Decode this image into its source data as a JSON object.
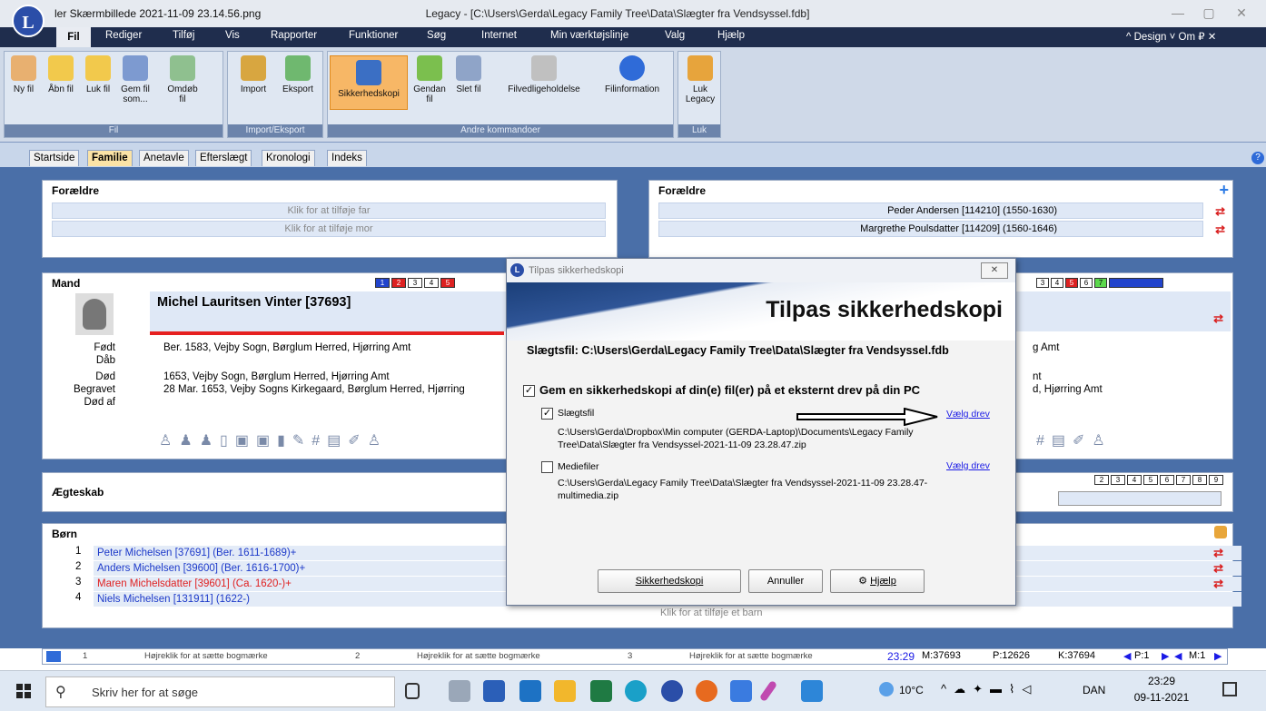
{
  "window": {
    "filename": "ler Skærmbillede 2021-11-09 23.14.56.png",
    "title": "Legacy - [C:\\Users\\Gerda\\Legacy Family Tree\\Data\\Slægter fra Vendsyssel.fdb]",
    "logo": "L"
  },
  "menu": {
    "items": [
      "Fil",
      "Rediger",
      "Tilføj",
      "Vis",
      "Rapporter",
      "Funktioner",
      "Søg",
      "Internet",
      "Min værktøjslinje",
      "Valg",
      "Hjælp"
    ],
    "right": "^ Design  ˅ Om ₽ ✕"
  },
  "ribbon": {
    "groups": [
      {
        "label": "Fil"
      },
      {
        "label": "Import/Eksport"
      },
      {
        "label": "Andre kommandoer"
      },
      {
        "label": "Luk"
      }
    ],
    "buttons": [
      "Ny fil",
      "Åbn fil",
      "Luk fil",
      "Gem fil som...",
      "Omdøb fil",
      "Import",
      "Eksport",
      "Sikkerhedskopi",
      "Gendan fil",
      "Slet fil",
      "Filvedligeholdelse",
      "Filinformation",
      "Luk Legacy"
    ]
  },
  "tabs": [
    "Startside",
    "Familie",
    "Anetavle",
    "Efterslægt",
    "Kronologi",
    "Indeks"
  ],
  "parents_left": {
    "title": "Forældre",
    "father": "Klik for at tilføje far",
    "mother": "Klik for at tilføje mor"
  },
  "parents_right": {
    "title": "Forældre",
    "father": "Peder Andersen [114210] (1550-1630)",
    "mother": "Margrethe Poulsdatter [114209] (1560-1646)"
  },
  "man": {
    "title": "Mand",
    "name": "Michel Lauritsen Vinter [37693]",
    "labels": [
      "Født",
      "Dåb",
      "Død",
      "Begravet",
      "Død af"
    ],
    "born": "Ber. 1583, Vejby Sogn, Børglum Herred, Hjørring Amt",
    "baptism": "",
    "death": "1653, Vejby Sogn, Børglum Herred, Hjørring Amt",
    "burial": "28 Mar. 1653, Vejby Sogns Kirkegaard, Børglum Herred, Hjørring",
    "right_born": "g Amt",
    "right_death": "nt",
    "right_burial": "d, Hjørring Amt",
    "colornums": [
      "1",
      "2",
      "3",
      "4",
      "5"
    ],
    "rightnums": [
      "3",
      "4",
      "5",
      "6",
      "7"
    ]
  },
  "marriage": {
    "title": "Ægteskab",
    "nums": [
      "2",
      "3",
      "4",
      "5",
      "6",
      "7",
      "8",
      "9"
    ]
  },
  "children": {
    "title": "Børn",
    "items": [
      {
        "n": "1",
        "text": "Peter Michelsen [37691] (Ber. 1611-1689)+"
      },
      {
        "n": "2",
        "text": "Anders Michelsen [39600] (Ber. 1616-1700)+"
      },
      {
        "n": "3",
        "text": "Maren Michelsdatter [39601] (Ca. 1620-)+"
      },
      {
        "n": "4",
        "text": "Niels Michelsen [131911] (1622-)"
      }
    ],
    "add": "Klik for at tilføje et barn"
  },
  "bookmarks": {
    "items": [
      "1",
      "Højreklik for at sætte bogmærke",
      "2",
      "Højreklik for at sætte bogmærke",
      "3",
      "Højreklik for at sætte bogmærke"
    ],
    "time": "23:29",
    "m": "M:37693",
    "p": "P:12626",
    "k": "K:37694",
    "pnav": "P:1",
    "mnav": "M:1"
  },
  "dialog": {
    "title": "Tilpas sikkerhedskopi",
    "heading": "Tilpas sikkerhedskopi",
    "file": "Slægtsfil: C:\\Users\\Gerda\\Legacy Family Tree\\Data\\Slægter fra Vendsyssel.fdb",
    "external": "Gem en sikkerhedskopi af din(e) fil(er) på et eksternt drev på din PC",
    "item1_label": "Slægtsfil",
    "item1_path": "C:\\Users\\Gerda\\Dropbox\\Min computer (GERDA-Laptop)\\Documents\\Legacy Family Tree\\Data\\Slægter fra Vendsyssel-2021-11-09 23.28.47.zip",
    "item1_link": "Vælg drev",
    "item2_label": "Mediefiler",
    "item2_path": "C:\\Users\\Gerda\\Legacy Family Tree\\Data\\Slægter fra Vendsyssel-2021-11-09 23.28.47-multimedia.zip",
    "item2_link": "Vælg drev",
    "btn_backup": "Sikkerhedskopi",
    "btn_cancel": "Annuller",
    "btn_help": "Hjælp",
    "close": "✕"
  },
  "taskbar": {
    "search": "Skriv her for at søge",
    "weather": "10°C",
    "lang": "DAN",
    "time": "23:29",
    "date": "09-11-2021"
  }
}
